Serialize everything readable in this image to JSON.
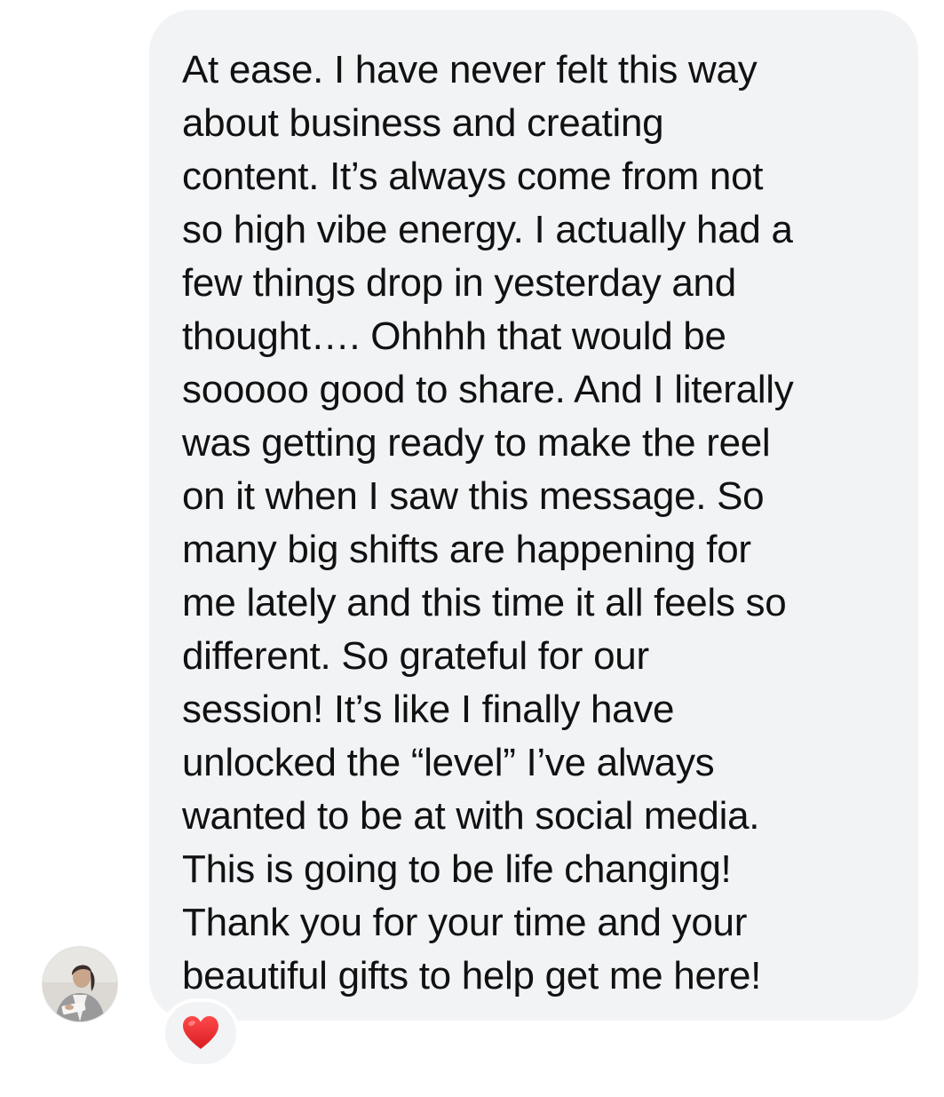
{
  "message": {
    "lines": [
      "At ease. I have never felt this way",
      "about business and creating",
      "content. It’s always come from not",
      "so high vibe energy. I actually had a",
      "few things drop in yesterday and",
      "thought…. Ohhhh that would be",
      "sooooo good to share. And I literally",
      "was getting ready to make the reel",
      "on it when I saw this message. So",
      "many big shifts are happening for",
      "me lately and this time it all feels so",
      "different. So grateful for our",
      "session! It’s like I finally have",
      "unlocked the “level” I’ve always",
      "wanted to be at with social media.",
      "This is going to be life changing!",
      "Thank you for your time and your",
      "beautiful gifts to help get me here!"
    ]
  },
  "avatar": {
    "icon": "sender-avatar-photo"
  },
  "reaction": {
    "icon": "heart-icon",
    "color": "#e8282b"
  },
  "colors": {
    "bubble_background": "#f2f3f5",
    "text": "#111111",
    "page_background": "#ffffff"
  }
}
